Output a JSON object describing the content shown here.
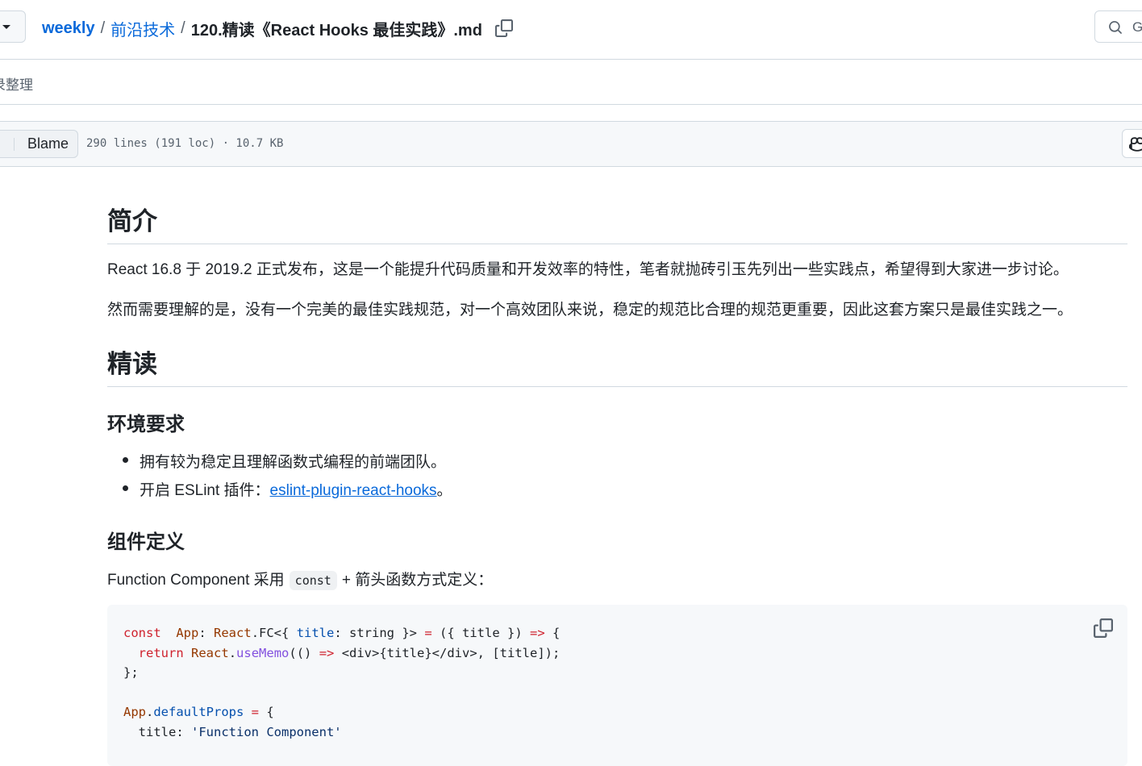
{
  "breadcrumb": {
    "repo": "weekly",
    "folder": "前沿技术",
    "separator": "/",
    "file": "120.精读《React Hooks 最佳实践》.md"
  },
  "search": {
    "hint": "G"
  },
  "commit": {
    "message": "录整理"
  },
  "file_header": {
    "blame_label": "Blame",
    "info": "290 lines (191 loc) · 10.7 KB"
  },
  "content": {
    "h_intro": "简介",
    "p_intro_1": "React 16.8 于 2019.2 正式发布，这是一个能提升代码质量和开发效率的特性，笔者就抛砖引玉先列出一些实践点，希望得到大家进一步讨论。",
    "p_intro_2": "然而需要理解的是，没有一个完美的最佳实践规范，对一个高效团队来说，稳定的规范比合理的规范更重要，因此这套方案只是最佳实践之一。",
    "h_read": "精读",
    "h_env": "环境要求",
    "env_items": [
      "拥有较为稳定且理解函数式编程的前端团队。",
      "开启 ESLint 插件："
    ],
    "eslint_link": "eslint-plugin-react-hooks",
    "eslint_suffix": "。",
    "h_component": "组件定义",
    "p_component_before": "Function Component 采用",
    "p_component_code": "const",
    "p_component_after": "+ 箭头函数方式定义："
  },
  "code_lines": [
    [
      [
        "k",
        "const"
      ],
      [
        "",
        "  "
      ],
      [
        "n",
        "App"
      ],
      [
        "",
        ": "
      ],
      [
        "n",
        "React"
      ],
      [
        "",
        ".FC<{ "
      ],
      [
        "t",
        "title"
      ],
      [
        "",
        ": string }> "
      ],
      [
        "k",
        "="
      ],
      [
        "",
        " ({ title }) "
      ],
      [
        "k",
        "=>"
      ],
      [
        "",
        " {"
      ]
    ],
    [
      [
        "",
        "  "
      ],
      [
        "k",
        "return"
      ],
      [
        "",
        " "
      ],
      [
        "n",
        "React"
      ],
      [
        "",
        "."
      ],
      [
        "f",
        "useMemo"
      ],
      [
        "",
        "(() "
      ],
      [
        "k",
        "=>"
      ],
      [
        "",
        " <div>{title}</div>, [title]);"
      ]
    ],
    [
      [
        "",
        "};"
      ]
    ],
    [
      [
        "",
        ""
      ]
    ],
    [
      [
        "n",
        "App"
      ],
      [
        "",
        "."
      ],
      [
        "t",
        "defaultProps"
      ],
      [
        "",
        " "
      ],
      [
        "k",
        "="
      ],
      [
        "",
        " {"
      ]
    ],
    [
      [
        "",
        "  title: "
      ],
      [
        "s",
        "'Function Component'"
      ]
    ]
  ]
}
